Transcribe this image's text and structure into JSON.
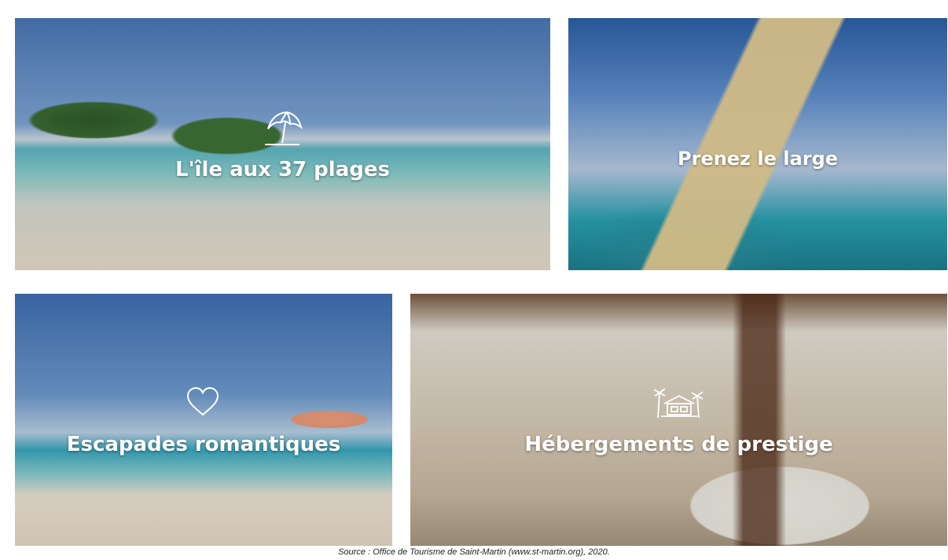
{
  "tiles": [
    {
      "caption": "L'île aux 37 plages",
      "icon": "beach-umbrella-icon"
    },
    {
      "caption": "Prenez le large",
      "icon": ""
    },
    {
      "caption": "Escapades romantiques",
      "icon": "heart-icon"
    },
    {
      "caption": "Hébergements de prestige",
      "icon": "palm-house-icon"
    }
  ],
  "source": "Source : Office de Tourisme de Saint-Martin (www.st-martin.org), 2020."
}
